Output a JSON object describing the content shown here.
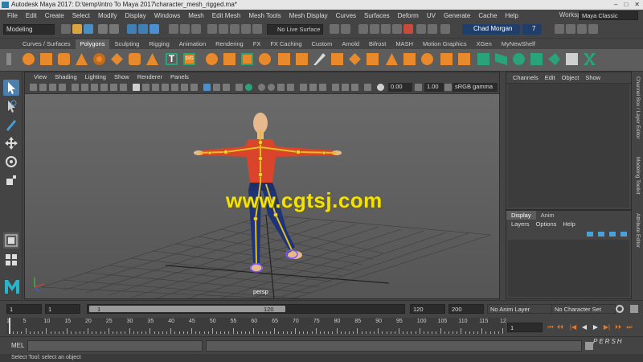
{
  "window": {
    "title": "Autodesk Maya 2017: D:\\temp\\Intro To Maya 2017\\character_mesh_rigged.ma*",
    "controls": [
      "–",
      "□",
      "✕"
    ]
  },
  "menubar": {
    "items": [
      "File",
      "Edit",
      "Create",
      "Select",
      "Modify",
      "Display",
      "Windows",
      "Mesh",
      "Edit Mesh",
      "Mesh Tools",
      "Mesh Display",
      "Curves",
      "Surfaces",
      "Deform",
      "UV",
      "Generate",
      "Cache",
      "Help"
    ],
    "workspace_label": "Workspace :",
    "workspace_value": "Maya Classic"
  },
  "statusline": {
    "mode": "Modeling",
    "live_surface": "No Live Surface",
    "user": "Chad Morgan",
    "notifications": "7"
  },
  "shelf": {
    "tabs": [
      "Curves / Surfaces",
      "Polygons",
      "Sculpting",
      "Rigging",
      "Animation",
      "Rendering",
      "FX",
      "FX Caching",
      "Custom",
      "Arnold",
      "Bifrost",
      "MASH",
      "Motion Graphics",
      "XGen",
      "MyNewShelf"
    ],
    "active_tab": "Polygons",
    "text_icons": {
      "t": "T",
      "svg": "SVG"
    }
  },
  "viewport": {
    "menu": [
      "View",
      "Shading",
      "Lighting",
      "Show",
      "Renderer",
      "Panels"
    ],
    "exposure": "0.00",
    "gamma": "1.00",
    "color_space": "sRGB gamma",
    "camera_label": "persp",
    "watermark": "www.cgtsj.com"
  },
  "channelbox": {
    "menu": [
      "Channels",
      "Edit",
      "Object",
      "Show"
    ]
  },
  "layers": {
    "tabs": [
      "Display",
      "Anim"
    ],
    "active_tab": "Display",
    "menu": [
      "Layers",
      "Options",
      "Help"
    ]
  },
  "side_tabs": [
    "Channel Box / Layer Editor",
    "Modeling Toolkit",
    "Attribute Editor"
  ],
  "range": {
    "start": "1",
    "playback_start": "1",
    "slider_start": "1",
    "slider_end": "120",
    "playback_end": "120",
    "end": "200",
    "anim_layer": "No Anim Layer",
    "character_set": "No Character Set"
  },
  "timeline": {
    "ticks": [
      "1",
      "5",
      "10",
      "15",
      "20",
      "25",
      "30",
      "35",
      "40",
      "45",
      "50",
      "55",
      "60",
      "65",
      "70",
      "75",
      "80",
      "85",
      "90",
      "95",
      "100",
      "105",
      "110",
      "115",
      "12"
    ],
    "current_frame": "1",
    "playback_buttons": [
      "⏮",
      "⏴⏴",
      "|◀",
      "◀",
      "▶",
      "▶|",
      "⏵⏵",
      "⏭"
    ]
  },
  "commandline": {
    "label": "MEL"
  },
  "helpline": {
    "text": "Select Tool: select an object"
  },
  "logo": "PERSH",
  "colors": {
    "accent_orange": "#e8892b",
    "shelf_teal": "#29a37a",
    "watermark_yellow": "#f4e300",
    "user_blue": "#1f3f6a"
  }
}
